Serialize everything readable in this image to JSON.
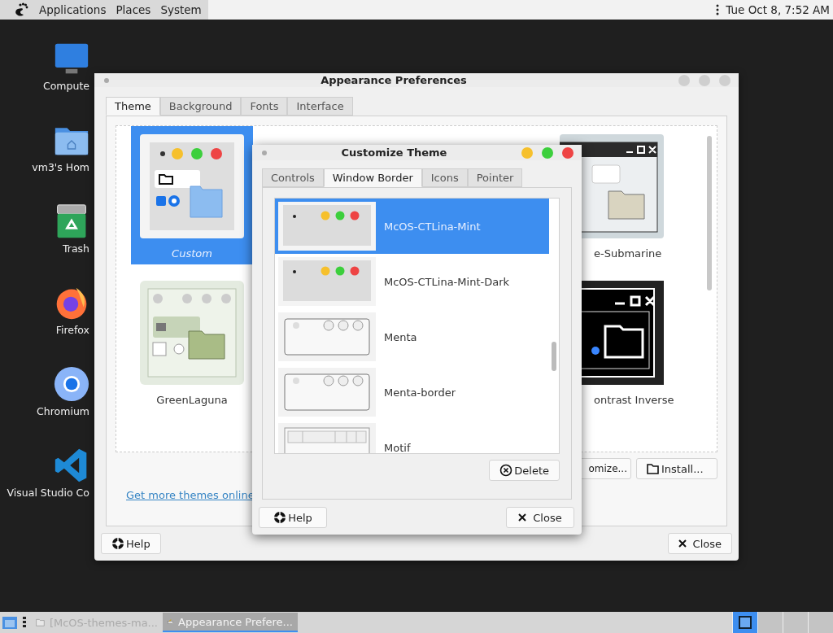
{
  "top_panel": {
    "menus": [
      "Applications",
      "Places",
      "System"
    ],
    "clock": "Tue Oct  8, 7:52 AM"
  },
  "desktop_icons": [
    {
      "label": "Compute",
      "kind": "computer"
    },
    {
      "label": "vm3's Hom",
      "kind": "home"
    },
    {
      "label": "Trash",
      "kind": "trash"
    },
    {
      "label": "Firefox",
      "kind": "firefox"
    },
    {
      "label": "Chromium",
      "kind": "chromium"
    },
    {
      "label": "Visual Studio Co",
      "kind": "vscode"
    }
  ],
  "appearance_window": {
    "title": "Appearance Preferences",
    "tabs": [
      {
        "label": "Theme",
        "selected": true
      },
      {
        "label": "Background",
        "selected": false
      },
      {
        "label": "Fonts",
        "selected": false
      },
      {
        "label": "Interface",
        "selected": false
      }
    ],
    "themes_left": [
      {
        "label": "Custom",
        "kind": "custom",
        "selected": true
      },
      {
        "label": "GreenLaguna",
        "kind": "green",
        "selected": false
      }
    ],
    "themes_right": [
      {
        "label": "e-Submarine",
        "kind": "submarine",
        "selected": false
      },
      {
        "label": "ontrast Inverse",
        "kind": "inverse",
        "selected": false
      }
    ],
    "customize_button": "omize...",
    "install_button": "Install...",
    "link": "Get more themes online",
    "help_button": "Help",
    "close_button": "Close"
  },
  "customize_dialog": {
    "title": "Customize Theme",
    "tabs": [
      {
        "label": "Controls",
        "selected": false
      },
      {
        "label": "Window Border",
        "selected": true
      },
      {
        "label": "Icons",
        "selected": false
      },
      {
        "label": "Pointer",
        "selected": false
      }
    ],
    "borders": [
      {
        "name": "McOS-CTLina-Mint",
        "kind": "mac",
        "selected": true
      },
      {
        "name": "McOS-CTLina-Mint-Dark",
        "kind": "mac",
        "selected": false
      },
      {
        "name": "Menta",
        "kind": "menta",
        "selected": false
      },
      {
        "name": "Menta-border",
        "kind": "menta",
        "selected": false
      },
      {
        "name": "Motif",
        "kind": "motif",
        "selected": false
      }
    ],
    "delete_button": "Delete",
    "help_button": "Help",
    "close_button": "Close"
  },
  "taskbar": {
    "items": [
      {
        "label": "[McOS-themes-ma...",
        "selected": false
      },
      {
        "label": "Appearance Prefere...",
        "selected": true
      }
    ]
  }
}
